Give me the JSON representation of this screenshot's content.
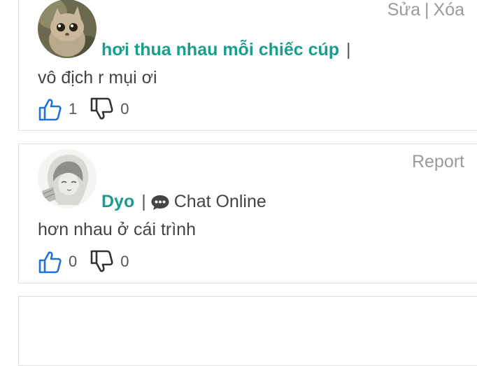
{
  "comments": [
    {
      "actions": {
        "edit": "Sửa",
        "separator": "|",
        "delete": "Xóa"
      },
      "user": {
        "name": "hơi thua nhau mỗi chiếc cúp",
        "trailing_separator": "|"
      },
      "text": "vô địch r mụi ơi",
      "likes": "1",
      "dislikes": "0",
      "avatar_icon": "plush-toy-avatar"
    },
    {
      "actions": {
        "report": "Report"
      },
      "user": {
        "name": "Dyo",
        "separator": "|",
        "chat_label": "Chat Online"
      },
      "text": "hơn nhau ở cái trình",
      "likes": "0",
      "dislikes": "0",
      "avatar_icon": "anime-sketch-avatar"
    }
  ],
  "colors": {
    "username": "#1a9c8e",
    "like_icon": "#1e73d8",
    "dislike_icon": "#333333",
    "action_text": "#9a9a9a",
    "border": "#dcdcdc"
  },
  "icons": {
    "like": "thumbs-up-icon",
    "dislike": "thumbs-down-icon",
    "chat": "chat-bubble-icon"
  }
}
